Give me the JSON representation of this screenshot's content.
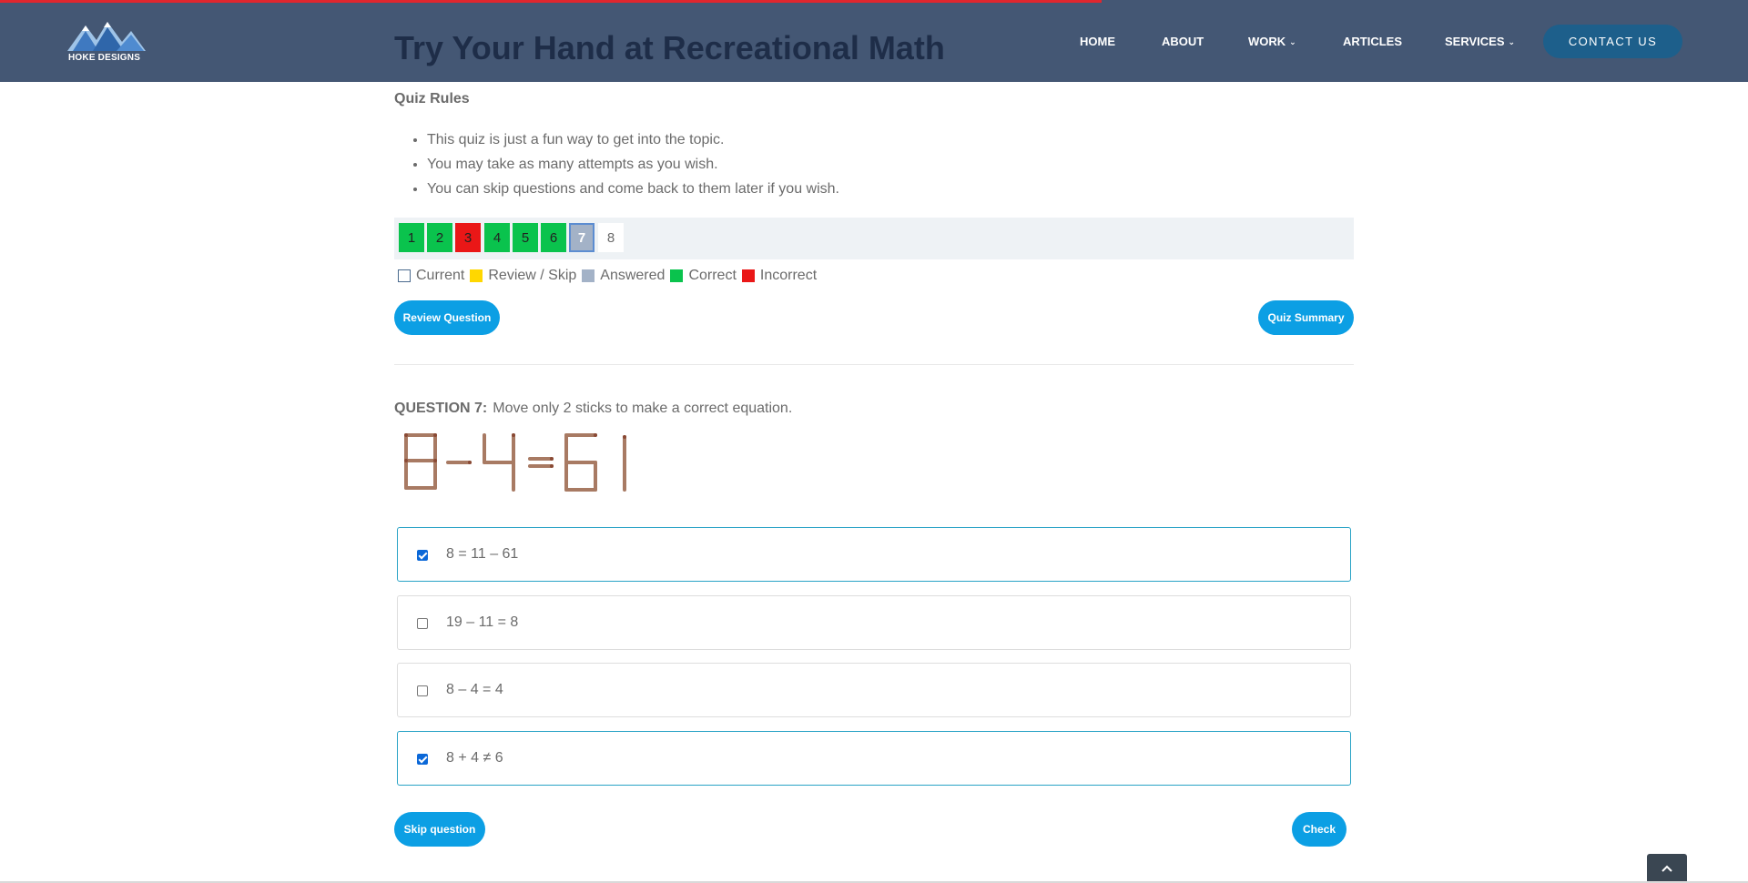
{
  "header": {
    "logo_text": "HOKE DESIGNS",
    "page_title": "Try Your Hand at Recreational Math",
    "nav": [
      {
        "label": "HOME"
      },
      {
        "label": "ABOUT"
      },
      {
        "label": "WORK",
        "has_dropdown": true
      },
      {
        "label": "ARTICLES"
      },
      {
        "label": "SERVICES",
        "has_dropdown": true
      }
    ],
    "contact_label": "CONTACT US",
    "colors": {
      "bar": "#445774",
      "title": "#1e2d48",
      "contact_bg": "#1d5f8b",
      "progress": "#e0262e"
    }
  },
  "quiz": {
    "rules_title": "Quiz Rules",
    "rules": [
      "This quiz is just a fun way to get into the topic.",
      "You may take as many attempts as you wish.",
      "You can skip questions and come back to them later if you wish."
    ],
    "question_nav": [
      {
        "label": "1",
        "status": "correct"
      },
      {
        "label": "2",
        "status": "correct"
      },
      {
        "label": "3",
        "status": "incorrect"
      },
      {
        "label": "4",
        "status": "correct"
      },
      {
        "label": "5",
        "status": "correct"
      },
      {
        "label": "6",
        "status": "correct"
      },
      {
        "label": "7",
        "status": "current"
      },
      {
        "label": "8",
        "status": "unanswered"
      }
    ],
    "legend": [
      {
        "label": "Current",
        "color": "#ffffff",
        "border": "#4a6a8e"
      },
      {
        "label": "Review / Skip",
        "color": "#ffd700"
      },
      {
        "label": "Answered",
        "color": "#a3b2c7"
      },
      {
        "label": "Correct",
        "color": "#0ac34d"
      },
      {
        "label": "Incorrect",
        "color": "#ea1717"
      }
    ],
    "review_button": "Review Question",
    "summary_button": "Quiz Summary",
    "question_label": "QUESTION 7:",
    "question_text": "Move only 2 sticks to make a correct equation.",
    "answers": [
      {
        "text": "8 = 11 – 61",
        "checked": true
      },
      {
        "text": "19 – 11 = 8",
        "checked": false
      },
      {
        "text": "8 – 4 = 4",
        "checked": false
      },
      {
        "text": "8 + 4 ≠ 6",
        "checked": true
      }
    ],
    "skip_button": "Skip question",
    "check_button": "Check",
    "accent": "#0c9fe4"
  }
}
